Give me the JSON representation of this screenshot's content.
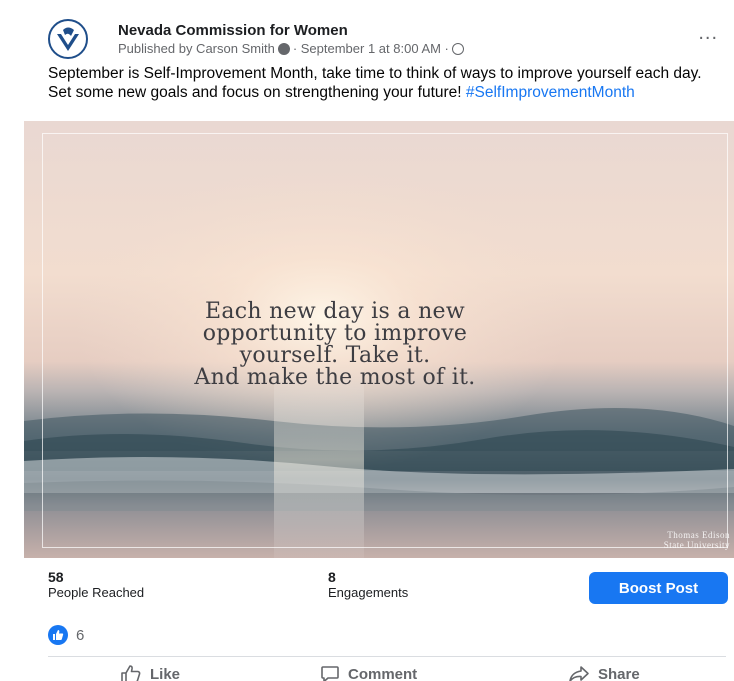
{
  "post": {
    "page_name": "Nevada Commission for Women",
    "published_prefix": "Published by Carson Smith",
    "published_time": "· September 1 at 8:00 AM ·",
    "more_label": "...",
    "caption_text": "September is Self-Improvement Month, take time to think of ways to improve yourself each day. Set some new goals and focus on strengthening your future! ",
    "hashtag": "#SelfImprovementMonth"
  },
  "image": {
    "quote_line_1": "Each new day is a new",
    "quote_line_2": "opportunity to improve",
    "quote_line_3": "yourself. Take it.",
    "quote_line_4": "And make the most of it.",
    "watermark_line_1": "Thomas Edison",
    "watermark_line_2": "State University"
  },
  "stats": {
    "reached_count": "58",
    "reached_label": "People Reached",
    "engagements_count": "8",
    "engagements_label": "Engagements",
    "boost_label": "Boost Post"
  },
  "reactions": {
    "count": "6"
  },
  "actions": {
    "like_label": "Like",
    "comment_label": "Comment",
    "share_label": "Share"
  },
  "colors": {
    "accent": "#1877f2",
    "meta_text": "#65676b"
  },
  "icons": [
    "more-options-icon",
    "privacy-info-icon",
    "globe-icon",
    "like-reaction-icon",
    "thumbs-up-icon",
    "comment-bubble-icon",
    "share-arrow-icon"
  ]
}
